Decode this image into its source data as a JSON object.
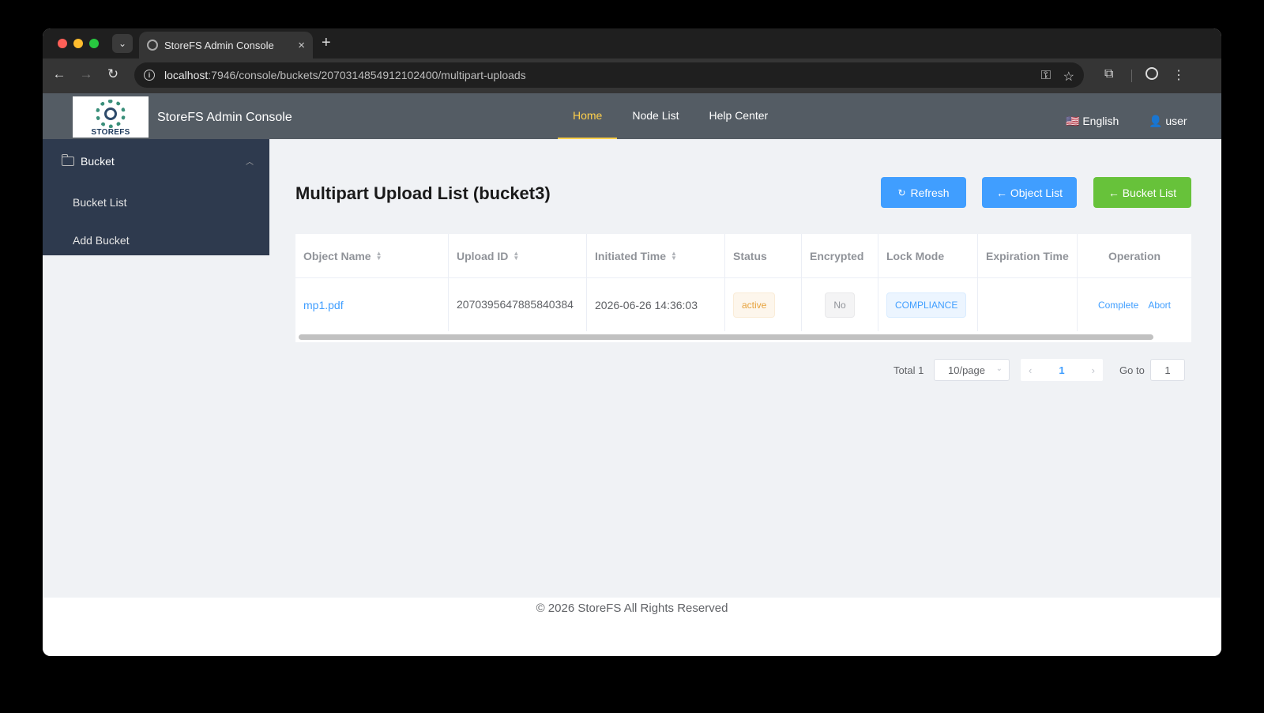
{
  "browser": {
    "tab_title": "StoreFS Admin Console",
    "tab_close": "×",
    "new_tab": "+",
    "url_host": "localhost",
    "url_rest": ":7946/console/buckets/2070314854912102400/multipart-uploads"
  },
  "header": {
    "logo_text": "STOREFS",
    "app_title": "StoreFS Admin Console",
    "menu": [
      {
        "label": "Home",
        "active": true
      },
      {
        "label": "Node List",
        "active": false
      },
      {
        "label": "Help Center",
        "active": false
      }
    ],
    "language": "🇺🇸 English",
    "user": "👤 user"
  },
  "sidebar": {
    "group_label": "Bucket",
    "items": [
      {
        "label": "Bucket List"
      },
      {
        "label": "Add Bucket"
      }
    ]
  },
  "main": {
    "title": "Multipart Upload List (bucket3)",
    "buttons": {
      "refresh": "Refresh",
      "object_list": "← Object List",
      "bucket_list": "← Bucket List"
    },
    "table": {
      "columns": [
        "Object Name",
        "Upload ID",
        "Initiated Time",
        "Status",
        "Encrypted",
        "Lock Mode",
        "Expiration Time",
        "Operation"
      ],
      "rows": [
        {
          "object_name": "mp1.pdf",
          "upload_id": "2070395647885840384",
          "initiated_time": "2026-06-26 14:36:03",
          "status": "active",
          "encrypted": "No",
          "lock_mode": "COMPLIANCE",
          "expiration_time": "",
          "operations": [
            "Complete",
            "Abort"
          ]
        }
      ]
    },
    "pagination": {
      "total_label": "Total 1",
      "page_size": "10/page",
      "current_page": "1",
      "goto_label": "Go to",
      "goto_value": "1"
    }
  },
  "footer": {
    "text": "© 2026 StoreFS All Rights Reserved"
  },
  "colors": {
    "primary": "#409eff",
    "success": "#67c23a",
    "menu_active": "#ffd04b",
    "header_bg": "#545c64",
    "sidebar_bg": "#2e3a4e"
  }
}
